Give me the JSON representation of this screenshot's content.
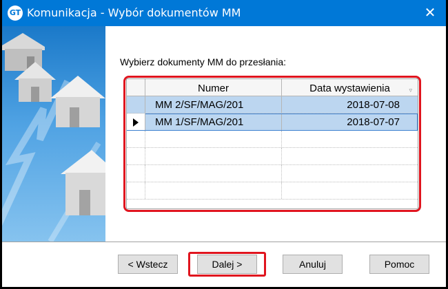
{
  "window": {
    "title": "Komunikacja - Wybór dokumentów MM",
    "app_icon_text": "GT",
    "close_glyph": "✕"
  },
  "main": {
    "instruction": "Wybierz dokumenty MM do przesłania:",
    "grid": {
      "columns": [
        "Numer",
        "Data wystawienia"
      ],
      "sort_glyph": "▿",
      "rows": [
        {
          "numer": "MM 2/SF/MAG/201",
          "data": "2018-07-08",
          "selected": true,
          "current": false
        },
        {
          "numer": "MM 1/SF/MAG/201",
          "data": "2018-07-07",
          "selected": true,
          "current": true
        }
      ],
      "empty_rows": 4
    }
  },
  "buttons": {
    "back": "< Wstecz",
    "next": "Dalej >",
    "cancel": "Anuluj",
    "help": "Pomoc"
  },
  "colors": {
    "titlebar": "#0078d7",
    "highlight": "#e0141e",
    "selection": "#bcd6f0"
  }
}
